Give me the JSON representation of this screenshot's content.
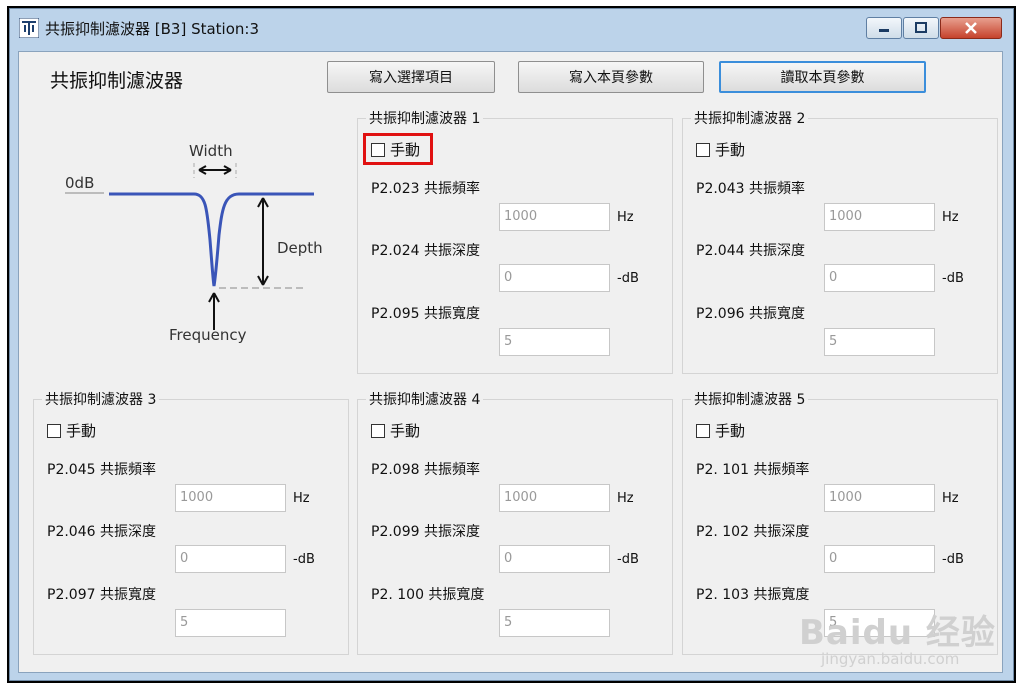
{
  "window": {
    "title": "共振抑制濾波器 [B3] Station:3",
    "controls": [
      "minimize",
      "maximize",
      "close"
    ]
  },
  "page": {
    "heading": "共振抑制濾波器"
  },
  "toolbar": {
    "write_selected": "寫入選擇項目",
    "write_page": "寫入本頁參數",
    "read_page": "讀取本頁參數"
  },
  "diagram": {
    "width_label": "Width",
    "zero_db_label": "0dB",
    "depth_label": "Depth",
    "frequency_label": "Frequency"
  },
  "filters": [
    {
      "title": "共振抑制濾波器 1",
      "manual_label": "手動",
      "manual_checked": false,
      "highlighted": true,
      "freq": {
        "label": "P2.023 共振頻率",
        "value": "1000",
        "unit": "Hz"
      },
      "depth": {
        "label": "P2.024 共振深度",
        "value": "0",
        "unit": "-dB"
      },
      "width": {
        "label": "P2.095 共振寬度",
        "value": "5"
      }
    },
    {
      "title": "共振抑制濾波器 2",
      "manual_label": "手動",
      "manual_checked": false,
      "freq": {
        "label": "P2.043 共振頻率",
        "value": "1000",
        "unit": "Hz"
      },
      "depth": {
        "label": "P2.044 共振深度",
        "value": "0",
        "unit": "-dB"
      },
      "width": {
        "label": "P2.096 共振寬度",
        "value": "5"
      }
    },
    {
      "title": "共振抑制濾波器 3",
      "manual_label": "手動",
      "manual_checked": false,
      "freq": {
        "label": "P2.045 共振頻率",
        "value": "1000",
        "unit": "Hz"
      },
      "depth": {
        "label": "P2.046 共振深度",
        "value": "0",
        "unit": "-dB"
      },
      "width": {
        "label": "P2.097 共振寬度",
        "value": "5"
      }
    },
    {
      "title": "共振抑制濾波器 4",
      "manual_label": "手動",
      "manual_checked": false,
      "freq": {
        "label": "P2.098 共振頻率",
        "value": "1000",
        "unit": "Hz"
      },
      "depth": {
        "label": "P2.099 共振深度",
        "value": "0",
        "unit": "-dB"
      },
      "width": {
        "label": "P2. 100 共振寬度",
        "value": "5"
      }
    },
    {
      "title": "共振抑制濾波器 5",
      "manual_label": "手動",
      "manual_checked": false,
      "freq": {
        "label": "P2. 101 共振頻率",
        "value": "1000",
        "unit": "Hz"
      },
      "depth": {
        "label": "P2. 102 共振深度",
        "value": "0",
        "unit": "-dB"
      },
      "width": {
        "label": "P2. 103 共振寬度",
        "value": "5"
      }
    }
  ],
  "watermark": {
    "brand": "Baidu 经验",
    "url": "jingyan.baidu.com"
  }
}
